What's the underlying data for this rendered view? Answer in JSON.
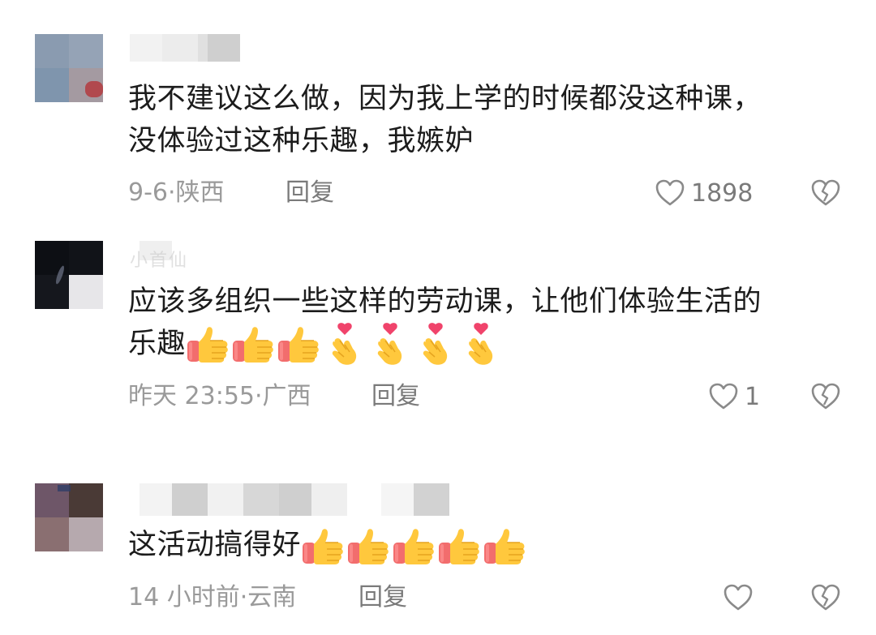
{
  "comments": [
    {
      "text_lines": [
        "我不建议这么做，因为我上学的时候都没这种课，",
        "没体验过这种乐趣，我嫉妒"
      ],
      "date": "9-6",
      "location": "陕西",
      "reply_label": "回复",
      "likes": "1898",
      "emojis": []
    },
    {
      "username_partial": "小首仙",
      "text_lines": [
        "应该多组织一些这样的劳动课，让他们体验生活的",
        "乐趣"
      ],
      "date": "昨天 23:55",
      "location": "广西",
      "reply_label": "回复",
      "likes": "1",
      "emojis": [
        "thumbs-up",
        "thumbs-up",
        "thumbs-up",
        "finger-heart",
        "finger-heart",
        "finger-heart",
        "finger-heart"
      ]
    },
    {
      "text_lines": [
        "这活动搞得好"
      ],
      "date": "14 小时前",
      "location": "云南",
      "reply_label": "回复",
      "likes": "",
      "emojis": [
        "thumbs-up",
        "thumbs-up",
        "thumbs-up",
        "thumbs-up",
        "thumbs-up"
      ]
    }
  ],
  "separator": "·",
  "colors": {
    "text": "#1c1c1c",
    "meta": "#9a9a9a",
    "action": "#7a7a7a",
    "thumb_yellow": "#ffc83d",
    "thumb_cuff": "#f26d6d",
    "heart": "#f0436b"
  },
  "icons": [
    "heart-outline-icon",
    "broken-heart-icon",
    "thumbs-up-emoji",
    "finger-heart-emoji"
  ]
}
